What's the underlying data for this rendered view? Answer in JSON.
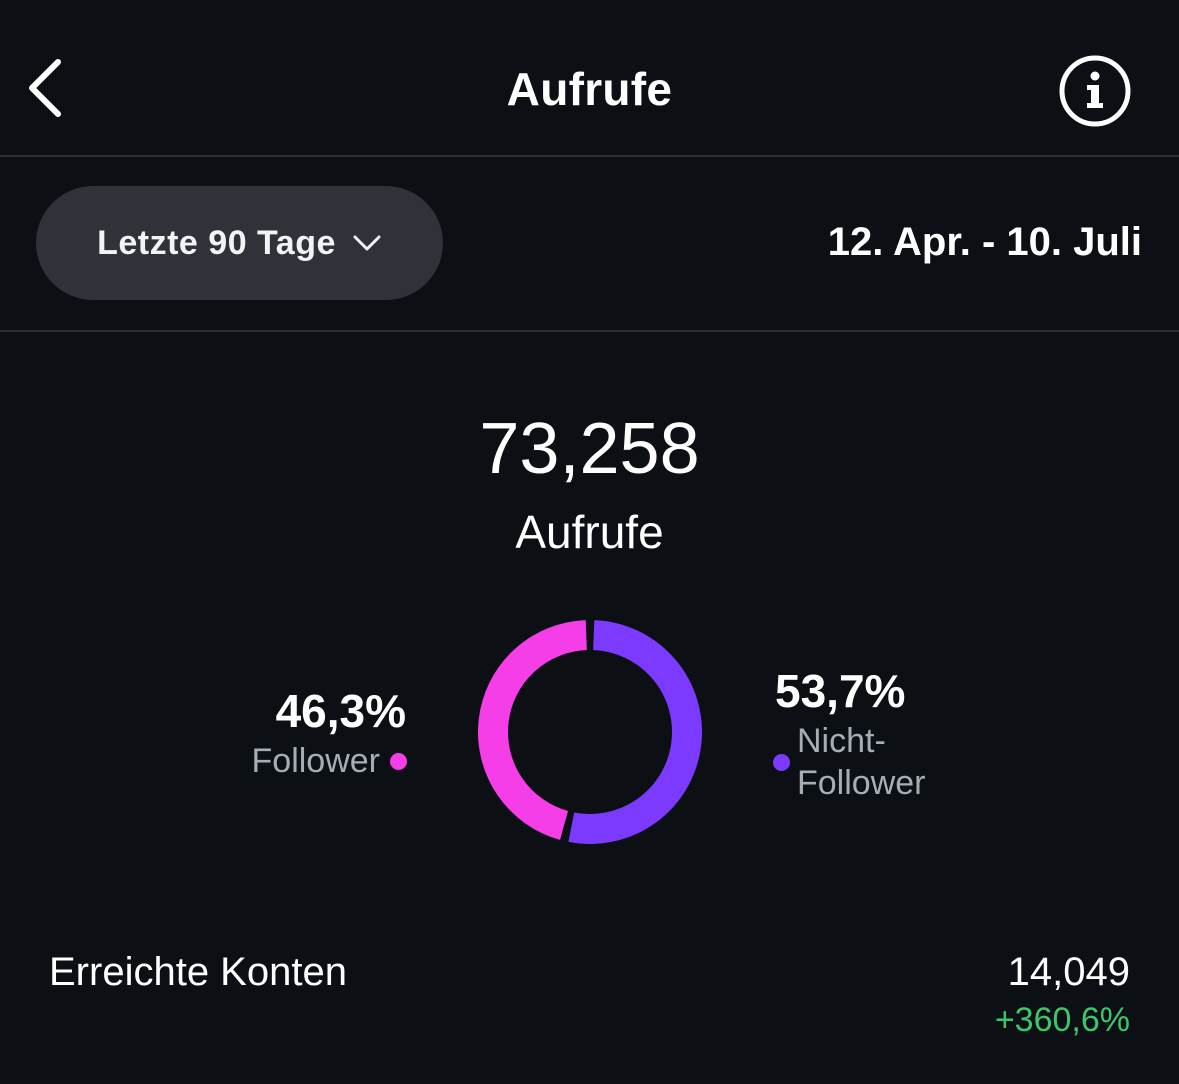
{
  "header": {
    "title": "Aufrufe",
    "back_icon": "chevron-left-icon",
    "info_icon": "info-icon"
  },
  "filter": {
    "range_label": "Letzte 90 Tage",
    "dropdown_icon": "chevron-down-icon",
    "date_range": "12. Apr. - 10. Juli"
  },
  "summary": {
    "total": "73,258",
    "label": "Aufrufe"
  },
  "breakdown": {
    "follower": {
      "percent": "46,3%",
      "label": "Follower",
      "value": 46.3,
      "color": "#f53ee8"
    },
    "non_follower": {
      "percent": "53,7%",
      "label": "Nicht-Follower",
      "value": 53.7,
      "color": "#7c3aff"
    }
  },
  "metrics": {
    "reached_accounts": {
      "label": "Erreichte Konten",
      "value": "14,049",
      "change": "+360,6%",
      "change_color": "#3dc56a"
    }
  }
}
